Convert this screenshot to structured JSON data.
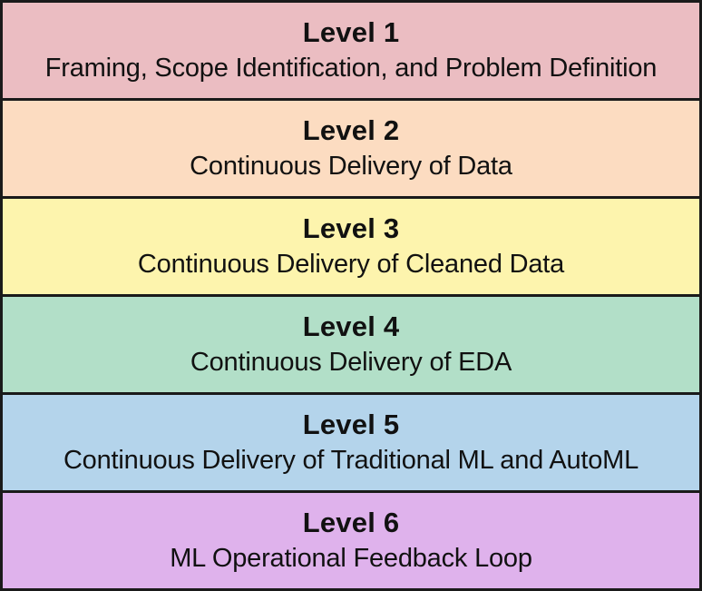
{
  "diagram": {
    "levels": [
      {
        "title": "Level 1",
        "description": "Framing, Scope Identification, and Problem Definition",
        "color": "#ebbdc2"
      },
      {
        "title": "Level 2",
        "description": "Continuous Delivery of Data",
        "color": "#fcdcc1"
      },
      {
        "title": "Level 3",
        "description": "Continuous Delivery of Cleaned Data",
        "color": "#fdf4ad"
      },
      {
        "title": "Level 4",
        "description": "Continuous Delivery of EDA",
        "color": "#b2dfc8"
      },
      {
        "title": "Level 5",
        "description": "Continuous Delivery of Traditional ML and AutoML",
        "color": "#b4d4eb"
      },
      {
        "title": "Level 6",
        "description": "ML Operational Feedback Loop",
        "color": "#dfb2ec"
      }
    ]
  }
}
